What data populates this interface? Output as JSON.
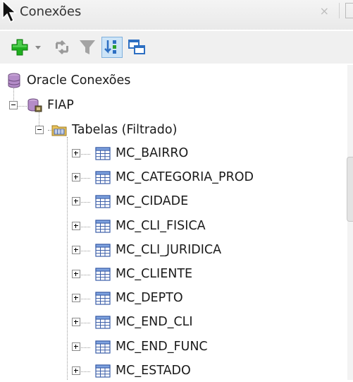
{
  "panel": {
    "title": "Conexões"
  },
  "toolbar": {
    "buttons": [
      {
        "name": "add-connection",
        "icon": "green-plus-icon"
      },
      {
        "name": "add-dropdown",
        "icon": "chevron-down-icon"
      },
      {
        "name": "refresh",
        "icon": "refresh-icon"
      },
      {
        "name": "filter",
        "icon": "filter-icon"
      },
      {
        "name": "schema-browser",
        "icon": "sort-icon"
      },
      {
        "name": "manage-windows",
        "icon": "windows-icon"
      }
    ]
  },
  "tree": {
    "root": {
      "label": "Oracle Conexões",
      "icon": "database-icon"
    },
    "connection": {
      "label": "FIAP",
      "icon": "db-connection-icon"
    },
    "folder": {
      "label": "Tabelas (Filtrado)",
      "icon": "folder-icon"
    },
    "tables": [
      {
        "label": "MC_BAIRRO"
      },
      {
        "label": "MC_CATEGORIA_PROD"
      },
      {
        "label": "MC_CIDADE"
      },
      {
        "label": "MC_CLI_FISICA"
      },
      {
        "label": "MC_CLI_JURIDICA"
      },
      {
        "label": "MC_CLIENTE"
      },
      {
        "label": "MC_DEPTO"
      },
      {
        "label": "MC_END_CLI"
      },
      {
        "label": "MC_END_FUNC"
      },
      {
        "label": "MC_ESTADO"
      }
    ]
  },
  "colors": {
    "accent_green": "#1aa31a",
    "table_blue": "#3b5ea8",
    "folder_yellow": "#e8c15a"
  }
}
